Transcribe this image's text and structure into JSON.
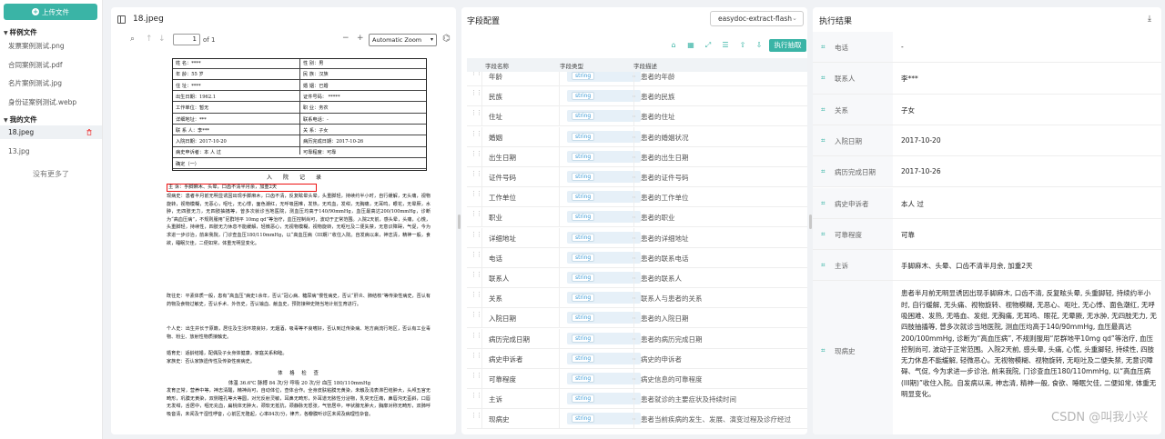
{
  "sidebar": {
    "upload_label": "上传文件",
    "sample_section": "样例文件",
    "sample_files": [
      "发票案例测试.png",
      "合同案例测试.pdf",
      "名片案例测试.jpg",
      "身份证案例测试.webp"
    ],
    "my_section": "我的文件",
    "my_files": [
      "18.jpeg",
      "13.jpg"
    ],
    "no_more": "没有更多了"
  },
  "viewer": {
    "title": "18.jpeg",
    "page": "1",
    "page_of": "of 1",
    "zoom": "Automatic Zoom",
    "form_rows": [
      [
        "姓    名：****",
        "性    别：男"
      ],
      [
        "年    龄：55 岁",
        "民    族：汉族"
      ],
      [
        "住    址：****",
        "婚    姻：已婚"
      ],
      [
        "出生日期：1962.1",
        "证件号码：  *****"
      ],
      [
        "工作单位：暂无",
        "职    业：务农"
      ],
      [
        "详细地址：***",
        "联系电话：-"
      ],
      [
        "联 系 人：李***",
        "关    系：子女"
      ],
      [
        "入院日期：2017-10-20",
        "病历完成日期：2017-10-26"
      ],
      [
        "病史申诉者：本 人 过",
        "可靠程度：可靠"
      ],
      [
        "确定（一）",
        ""
      ]
    ],
    "record_title": "入院记录",
    "chief_complaint": "主  诉：手脚麻木、头晕，口齿不清半月余，加重2天",
    "present_history": "现病史：患者半月前无明显诱因出现手脚麻木，口齿不清，反复眩晕头晕，头重脚轻，持续约半小时，自行缓解，无头痛，视物旋转，视物模糊，无恶心，呕吐，无心悸，面色潮红，无呼吸困难，发热，无鸡血，发绀，无胸痛，无耳鸣，眼花，无晕厥，水肿，无四肢无力，无四肢抽搐等，曾多次就诊当地医院，测血压均高于140/90mmHg，血压最高达200/100mmHg，诊断为“高血压病”，不规则服用“尼群地平 10mg qd”等治疗，血压控制尚可，波动于正常范围。入院2天前，感头晕，头痛，心慌，头重脚轻，持续性，四肢无力休息不能缓解，轻微恶心，无视物模糊，视物旋转，无呕吐及二便失禁，无意识障碍，气促，今为求进一步诊治，前来我院，门诊查血压180/110mmHg，以“高血压病（III期）”收住入院。自发病以来，神志清，精神一般，食欲，睡眠欠佳，二便如常，体重无明显变化。",
    "past_history": "既往史：平素体质一般，患有“高血压”病史1余年，否认“冠心病、糖尿病”慢性病史，否认“肝炎、肺结核”等传染性病史，否认有药物及食物过敏史，否认手术、外伤史，否认输血、献血史，预防接种史随当地计划生育进行。",
    "personal_history": "个人史：出生并长于原籍，居住及生活环境良好，无烟酒，吸毒等不良嗜好，否认到过传染病、地方病流行地区，否认有工业毒物、粉尘、放射性物质接触史。",
    "marital_history": "婚育史：适龄结婚，配偶及子女身体健康，家庭关系和睦。",
    "family_history": "家族史：否认家族遗传性及传染性疾病史。",
    "exam_title": "体  格  检  查",
    "vitals": "体温 36.6℃ 脉搏 84 次/分 呼吸 20 次/分 血压 180/110mmHg",
    "exam_text": "发育正常，营养中等，神志清醒，精神尚可，自动体位，查体合作。全身皮肤粘膜无黄染，未触及浅表淋巴结肿大，头颅五官无畸形，巩膜无黄染，双侧瞳孔等大等圆，对光反射灵敏，耳鼻无畸形，外耳道无脓性分泌物，乳突无压痛，鼻唇沟无歪斜，口唇无发绀，舌居中，咽无充血，扁桃体无肿大，颈软无抵抗，颈静脉无怒张，气管居中，甲状腺无肿大，胸廓对称无畸形，双肺呼吸音清，未闻及干湿性啰音，心前区无隆起，心率84次/分，律齐，各瓣膜听诊区未闻及病理性杂音。"
  },
  "config": {
    "title": "字段配置",
    "engine": "easydoc-extract-flash",
    "run_label": "执行抽取",
    "col_name": "字段名称",
    "col_type": "字段类型",
    "col_desc": "字段描述",
    "fields": [
      {
        "name": "年龄",
        "type": "string",
        "desc": "患者的年龄"
      },
      {
        "name": "民族",
        "type": "string",
        "desc": "患者的民族"
      },
      {
        "name": "住址",
        "type": "string",
        "desc": "患者的住址"
      },
      {
        "name": "婚姻",
        "type": "string",
        "desc": "患者的婚姻状况"
      },
      {
        "name": "出生日期",
        "type": "string",
        "desc": "患者的出生日期"
      },
      {
        "name": "证件号码",
        "type": "string",
        "desc": "患者的证件号码"
      },
      {
        "name": "工作单位",
        "type": "string",
        "desc": "患者的工作单位"
      },
      {
        "name": "职业",
        "type": "string",
        "desc": "患者的职业"
      },
      {
        "name": "详细地址",
        "type": "string",
        "desc": "患者的详细地址"
      },
      {
        "name": "电话",
        "type": "string",
        "desc": "患者的联系电话"
      },
      {
        "name": "联系人",
        "type": "string",
        "desc": "患者的联系人"
      },
      {
        "name": "关系",
        "type": "string",
        "desc": "联系人与患者的关系"
      },
      {
        "name": "入院日期",
        "type": "string",
        "desc": "患者的入院日期"
      },
      {
        "name": "病历完成日期",
        "type": "string",
        "desc": "患者的病历完成日期"
      },
      {
        "name": "病史申诉者",
        "type": "string",
        "desc": "病史的申诉者"
      },
      {
        "name": "可靠程度",
        "type": "string",
        "desc": "病史信息的可靠程度"
      },
      {
        "name": "主诉",
        "type": "string",
        "desc": "患者就诊的主要症状及持续时间"
      },
      {
        "name": "现病史",
        "type": "string",
        "desc": "患者当前疾病的发生、发展、演变过程及诊疗经过"
      }
    ]
  },
  "result": {
    "title": "执行结果",
    "rows": [
      {
        "key": "电话",
        "value": "-"
      },
      {
        "key": "联系人",
        "value": "李***"
      },
      {
        "key": "关系",
        "value": "子女"
      },
      {
        "key": "入院日期",
        "value": "2017-10-20"
      },
      {
        "key": "病历完成日期",
        "value": "2017-10-26"
      },
      {
        "key": "病史申诉者",
        "value": "本人 过"
      },
      {
        "key": "可靠程度",
        "value": "可靠"
      },
      {
        "key": "主诉",
        "value": "手脚麻木、头晕、口齿不清半月余, 加重2天"
      }
    ],
    "long_key": "现病史",
    "long_value": "患者半月前无明显诱因出现手脚麻木, 口齿不清, 反复眩头晕, 头重脚轻, 持续约半小时, 自行缓解, 无头痛、视物旋转、视物模糊, 无恶心、呕吐, 无心悸、面色潮红, 无呼吸困难、发热, 无咯血、发绀, 无胸痛, 无耳鸣、眼花, 无晕厥, 无水肿, 无四肢无力, 无四肢抽搐等, 曾多次就诊当地医院, 测血压均高于140/90mmHg, 血压最高达200/100mmHg, 诊断为“高血压病”, 不规则服用“尼群地平10mg qd”等治疗, 血压控制尚可, 波动于正常范围。入院2天前, 感头晕, 头痛, 心慌, 头重脚轻, 持续性, 四肢无力休息不能缓解, 轻微恶心。无视物模糊、视物旋转, 无呕吐及二便失禁, 无意识障碍、气促, 今为求进一步诊治, 前来我院, 门诊查血压180/110mmHg, 以“高血压病(III期)”收住入院。自发病以来, 神志清, 精神一般, 食欲、睡眠欠佳, 二便如常, 体重无明显变化。"
  },
  "watermark": "CSDN @叫我小兴",
  "colors": {
    "accent": "#3ab4a6",
    "tag": "#3a9ad6",
    "highlight": "#e11111"
  }
}
